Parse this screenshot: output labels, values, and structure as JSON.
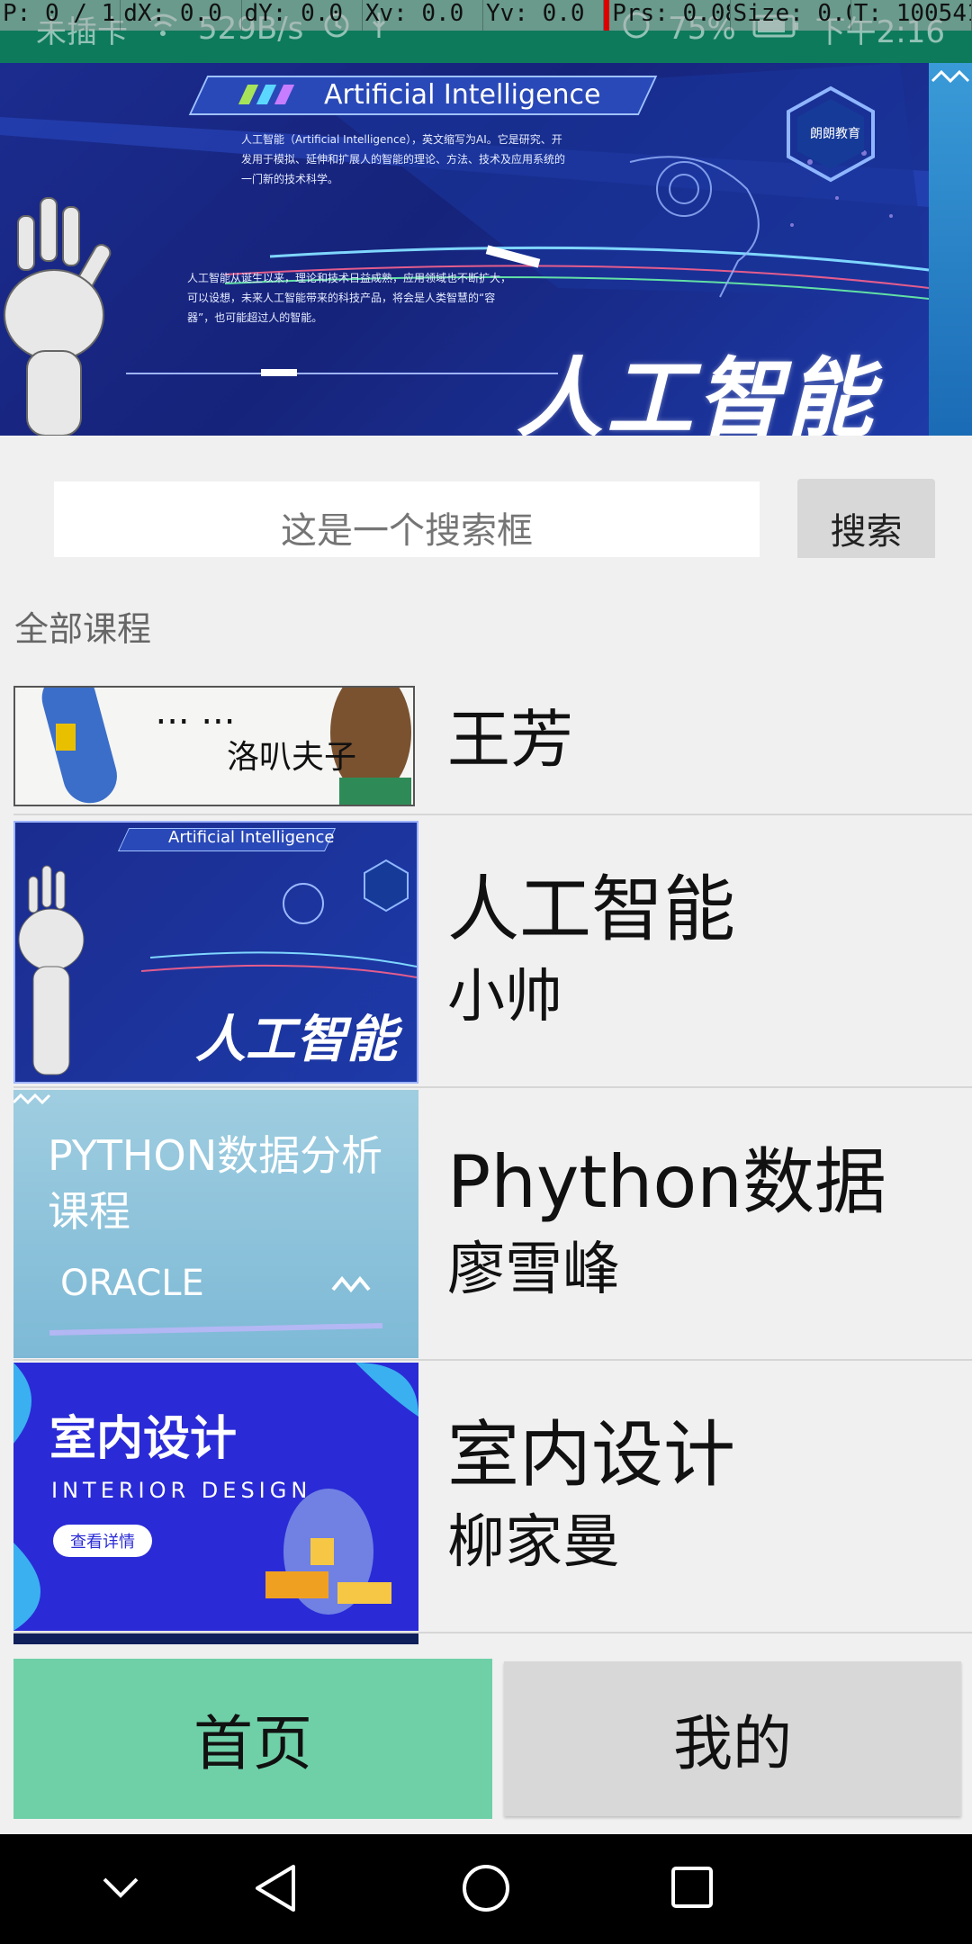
{
  "debug": {
    "pointer": "P: 0 / 1",
    "dx": "dX: 0.0",
    "dy": "dY: 0.0",
    "xv": "Xv: 0.0",
    "yv": "Yv: 0.0",
    "prs": "Prs: 0.08",
    "size": "Size: 0.0",
    "t": "T: 100541"
  },
  "status": {
    "sim": "未插卡",
    "speed": "529B/s",
    "battery": "75%",
    "time": "下午2:16"
  },
  "banner": {
    "header": "Artificial Intelligence",
    "para1": "人工智能（Artificial Intelligence），英文缩写为AI。它是研究、开发用于模拟、延伸和扩展人的智能的理论、方法、技术及应用系统的一门新的技术科学。",
    "para2": "人工智能从诞生以来，理论和技术日益成熟，应用领域也不断扩大，可以设想，未来人工智能带来的科技产品，将会是人类智慧的“容器”，也可能超过人的智能。",
    "big_title": "人工智能",
    "logo": "朗朗教育",
    "colors": {
      "primary": "#1b2c8f",
      "accent": "#3a9bd8"
    }
  },
  "search": {
    "placeholder": "这是一个搜索框",
    "button": "搜索"
  },
  "section_label": "全部课程",
  "courses": [
    {
      "title": "",
      "teacher": "王芳",
      "thumb_text": "洛叭夫子"
    },
    {
      "title": "人工智能",
      "teacher": "小帅",
      "thumb_text": "人工智能",
      "thumb_header": "Artificial Intelligence"
    },
    {
      "title": "Phython数据",
      "teacher": "廖雪峰",
      "thumb_text": "PYTHON数据分析课程",
      "thumb_sub": "ORACLE"
    },
    {
      "title": "室内设计",
      "teacher": "柳家曼",
      "thumb_text": "室内设计",
      "thumb_sub": "INTERIOR DESIGN",
      "thumb_btn": "查看详情"
    }
  ],
  "tabs": {
    "home": "首页",
    "mine": "我的",
    "active": "home",
    "active_color": "#6fd0a8"
  },
  "icons": [
    "wifi-icon",
    "alarm-icon",
    "usb-icon",
    "battery-icon",
    "back-icon",
    "home-icon",
    "recents-icon",
    "chevron-down-icon"
  ]
}
